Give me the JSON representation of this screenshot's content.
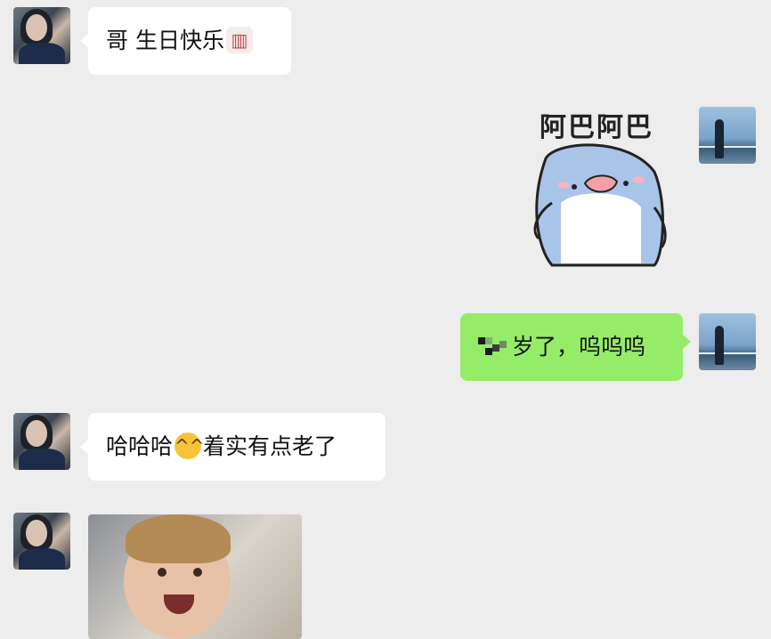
{
  "messages": [
    {
      "side": "left",
      "text_before": "哥 生日快乐",
      "emoji": "birthday-cake",
      "text_after": ""
    },
    {
      "side": "right",
      "type": "sticker",
      "sticker_text": "阿巴阿巴"
    },
    {
      "side": "right",
      "text": "岁了，呜呜呜"
    },
    {
      "side": "left",
      "text_before": "哈哈哈",
      "emoji": "laughing-face",
      "text_after": "着实有点老了"
    },
    {
      "side": "left",
      "type": "image",
      "description": "laughing-baby-photo"
    }
  ]
}
